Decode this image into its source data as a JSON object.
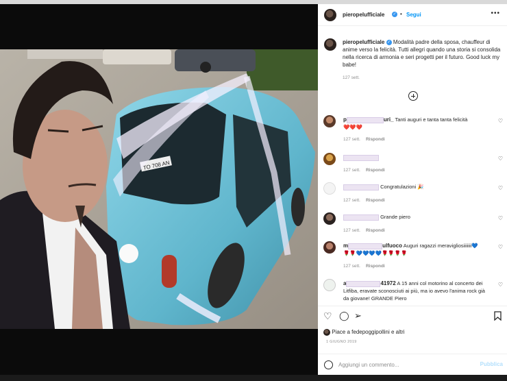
{
  "post": {
    "username": "pieropelufficiale",
    "follow_label": "Segui",
    "caption_username": "pieropelufficiale",
    "caption_text": "Modalità padre della sposa, chauffeur di anime verso la felicità. Tutti allegri quando una storia si consolida nella ricerca di armonia e seri progetti per il futuro. Good luck my babe!",
    "caption_time": "127 sett."
  },
  "comments": [
    {
      "user_start": "p",
      "user_end": "uri_",
      "text": "Tanti auguri e tanta tanta felicità",
      "extra": "❤️❤️❤️",
      "time": "127 sett.",
      "reply": "Rispondi"
    },
    {
      "user_start": "",
      "user_end": "",
      "text": "",
      "extra": "",
      "time": "127 sett.",
      "reply": "Rispondi"
    },
    {
      "user_start": "",
      "user_end": "",
      "text": "Congratulazioni 🎉",
      "extra": "",
      "time": "127 sett.",
      "reply": "Rispondi"
    },
    {
      "user_start": "",
      "user_end": "",
      "text": "Grande piero",
      "extra": "",
      "time": "127 sett.",
      "reply": "Rispondi"
    },
    {
      "user_start": "m",
      "user_end": "ulfuoco",
      "text": "Auguri ragazzi meravigliosiiiiiii💙",
      "extra": "🌹🌹💙💙💙💙🌹🌹🌹🌹",
      "time": "127 sett.",
      "reply": "Rispondi"
    },
    {
      "user_start": "a",
      "user_end": "41972",
      "text": "A 15 anni col motorino al concerto dei Litfiba, eravate sconosciuti ai più, ma io avevo l'anima rock già da giovane! GRANDE Piero",
      "extra": "",
      "time": "",
      "reply": ""
    }
  ],
  "likes_text": "Piace a fedepoggipollini e altri",
  "date_text": "1 GIUGNO 2019",
  "comment_input": {
    "placeholder": "Aggiungi un commento..."
  },
  "publish_label": "Pubblica",
  "photo": {
    "plate_text": "TO 708 AN"
  },
  "icons": [
    "heart-icon",
    "comment-icon",
    "share-icon",
    "bookmark-icon",
    "emoji-icon",
    "more-icon",
    "plus-icon",
    "verified-icon"
  ],
  "colors": {
    "accent": "#0095f6",
    "car": "#6fc2d8",
    "text": "#262626",
    "muted": "#8e8e8e"
  }
}
